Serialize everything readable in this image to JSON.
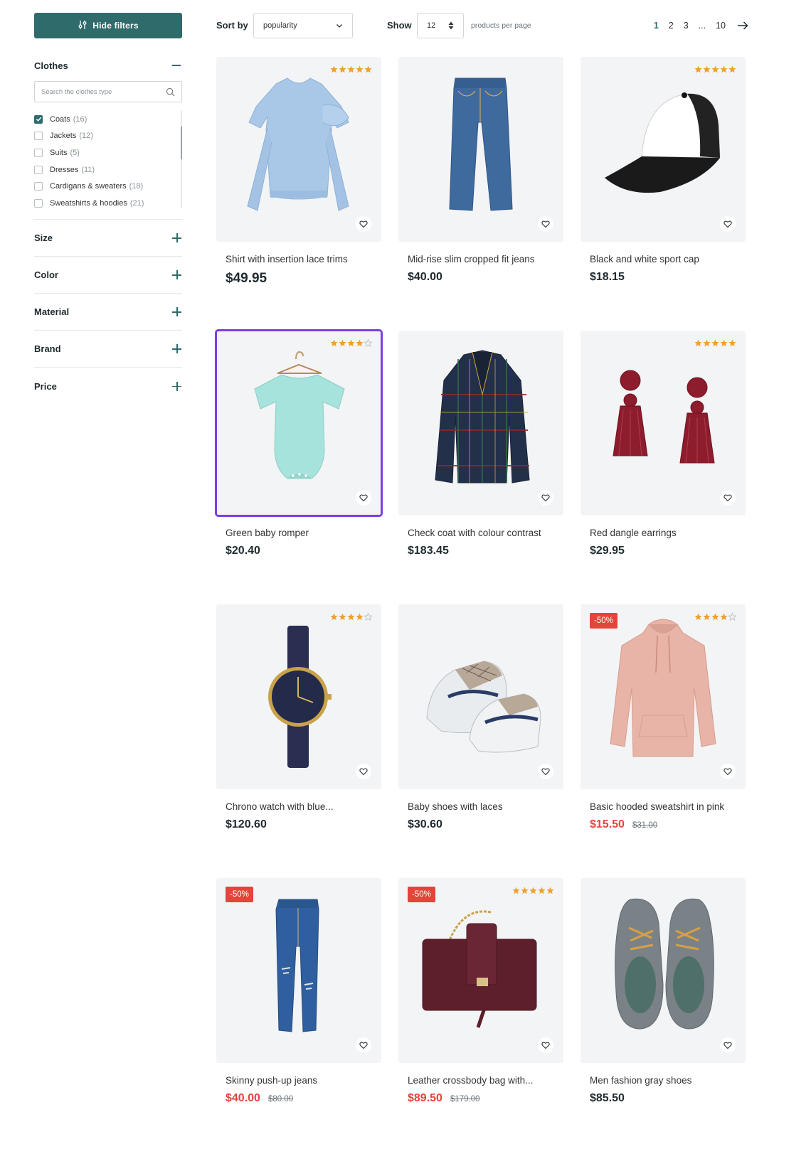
{
  "sidebar": {
    "hide_filters_label": "Hide filters",
    "clothes": {
      "title": "Clothes",
      "search_placeholder": "Search the clothes type",
      "items": [
        {
          "label": "Coats",
          "count": "(16)",
          "checked": true
        },
        {
          "label": "Jackets",
          "count": "(12)",
          "checked": false
        },
        {
          "label": "Suits",
          "count": "(5)",
          "checked": false
        },
        {
          "label": "Dresses",
          "count": "(11)",
          "checked": false
        },
        {
          "label": "Cardigans & sweaters",
          "count": "(18)",
          "checked": false
        },
        {
          "label": "Sweatshirts & hoodies",
          "count": "(21)",
          "checked": false
        }
      ]
    },
    "filters": [
      "Size",
      "Color",
      "Material",
      "Brand",
      "Price"
    ]
  },
  "toolbar": {
    "sort_label": "Sort by",
    "sort_value": "popularity",
    "show_label": "Show",
    "show_value": "12",
    "per_page_label": "products per page",
    "pages": [
      "1",
      "2",
      "3",
      "...",
      "10"
    ],
    "active_page": "1"
  },
  "colors": {
    "brand": "#2f6b6b",
    "star": "#f0a030",
    "sale": "#e4443a",
    "selected_outline": "#7b3fe4"
  },
  "products": [
    {
      "name": "Shirt with insertion lace trims",
      "price": "$49.95",
      "rating": 5,
      "badge": "",
      "old_price": "",
      "icon": "sweatshirt-icon"
    },
    {
      "name": "Mid-rise slim cropped fit jeans",
      "price": "$40.00",
      "rating": 0,
      "badge": "",
      "old_price": "",
      "icon": "jeans-icon"
    },
    {
      "name": "Black and white sport cap",
      "price": "$18.15",
      "rating": 5,
      "badge": "",
      "old_price": "",
      "icon": "cap-icon"
    },
    {
      "name": "Green baby romper",
      "price": "$20.40",
      "rating": 4,
      "badge": "",
      "old_price": "",
      "icon": "romper-icon",
      "selected": true
    },
    {
      "name": "Check coat with colour contrast",
      "price": "$183.45",
      "rating": 0,
      "badge": "",
      "old_price": "",
      "icon": "coat-icon"
    },
    {
      "name": "Red dangle earrings",
      "price": "$29.95",
      "rating": 5,
      "badge": "",
      "old_price": "",
      "icon": "earrings-icon"
    },
    {
      "name": "Chrono watch with blue...",
      "price": "$120.60",
      "rating": 4,
      "badge": "",
      "old_price": "",
      "icon": "watch-icon"
    },
    {
      "name": "Baby shoes with laces",
      "price": "$30.60",
      "rating": 0,
      "badge": "",
      "old_price": "",
      "icon": "baby-shoes-icon"
    },
    {
      "name": "Basic hooded sweatshirt in pink",
      "price": "$15.50",
      "rating": 4,
      "badge": "-50%",
      "old_price": "$31.00",
      "icon": "hoodie-icon"
    },
    {
      "name": "Skinny push-up jeans",
      "price": "$40.00",
      "rating": 0,
      "badge": "-50%",
      "old_price": "$80.00",
      "icon": "skinny-jeans-icon"
    },
    {
      "name": "Leather crossbody bag with...",
      "price": "$89.50",
      "rating": 5,
      "badge": "-50%",
      "old_price": "$179.00",
      "icon": "bag-icon"
    },
    {
      "name": "Men fashion gray shoes",
      "price": "$85.50",
      "rating": 0,
      "badge": "",
      "old_price": "",
      "icon": "shoes-icon"
    }
  ]
}
